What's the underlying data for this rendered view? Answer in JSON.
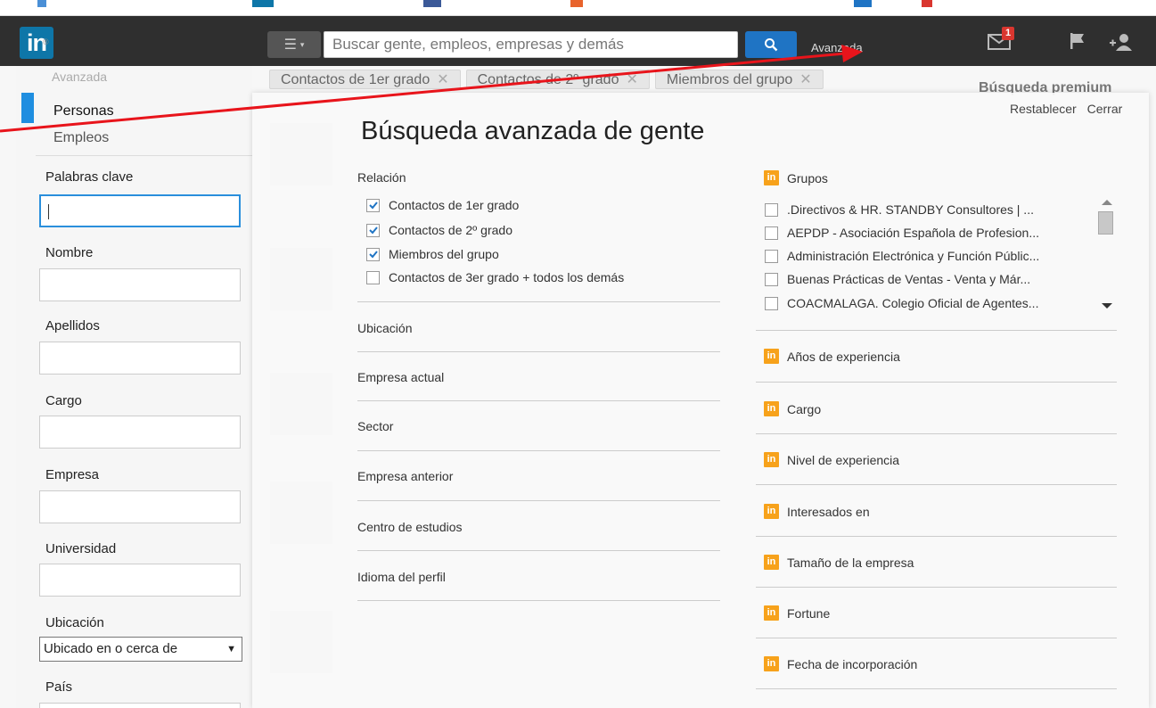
{
  "topbar": {
    "logo_text": "in",
    "logo_mark": "®",
    "search_placeholder": "Buscar gente, empleos, empresas y demás",
    "advanced_label": "Avanzada",
    "mail_count": "1",
    "colors": {
      "bar": "#2f2f2f",
      "search_button": "#1f74c4",
      "badge": "#d9362f"
    }
  },
  "chips": [
    {
      "label": "Contactos de 1er grado"
    },
    {
      "label": "Contactos de 2º grado"
    },
    {
      "label": "Miembros del grupo"
    }
  ],
  "background": {
    "premium_title": "Búsqueda premium",
    "sidebar_heading": "Avanzada"
  },
  "sidebar": {
    "tabs": {
      "active": "Personas",
      "inactive": "Empleos"
    },
    "fields": {
      "keywords": "Palabras clave",
      "first_name": "Nombre",
      "last_name": "Apellidos",
      "title": "Cargo",
      "company": "Empresa",
      "school": "Universidad",
      "location": "Ubicación",
      "country": "País"
    },
    "location_select": "Ubicado en o cerca de"
  },
  "modal": {
    "title": "Búsqueda avanzada de gente",
    "reset": "Restablecer",
    "close": "Cerrar",
    "relationship": {
      "label": "Relación",
      "options": [
        {
          "label": "Contactos de 1er grado",
          "checked": true
        },
        {
          "label": "Contactos de 2º grado",
          "checked": true
        },
        {
          "label": "Miembros del grupo",
          "checked": true
        },
        {
          "label": "Contactos de 3er grado + todos los demás",
          "checked": false
        }
      ]
    },
    "left_sections": [
      "Ubicación",
      "Empresa actual",
      "Sector",
      "Empresa anterior",
      "Centro de estudios",
      "Idioma del perfil"
    ],
    "premium_badge": "in",
    "groups": {
      "label": "Grupos",
      "items": [
        ".Directivos & HR. STANDBY Consultores | ...",
        "AEPDP - Asociación Española de Profesion...",
        "Administración Electrónica y Función Públic...",
        "Buenas Prácticas de Ventas - Venta y Már...",
        "COACMALAGA. Colegio Oficial de Agentes..."
      ]
    },
    "premium_sections": [
      "Años de experiencia",
      "Cargo",
      "Nivel de experiencia",
      "Interesados en",
      "Tamaño de la empresa",
      "Fortune",
      "Fecha de incorporación"
    ]
  }
}
